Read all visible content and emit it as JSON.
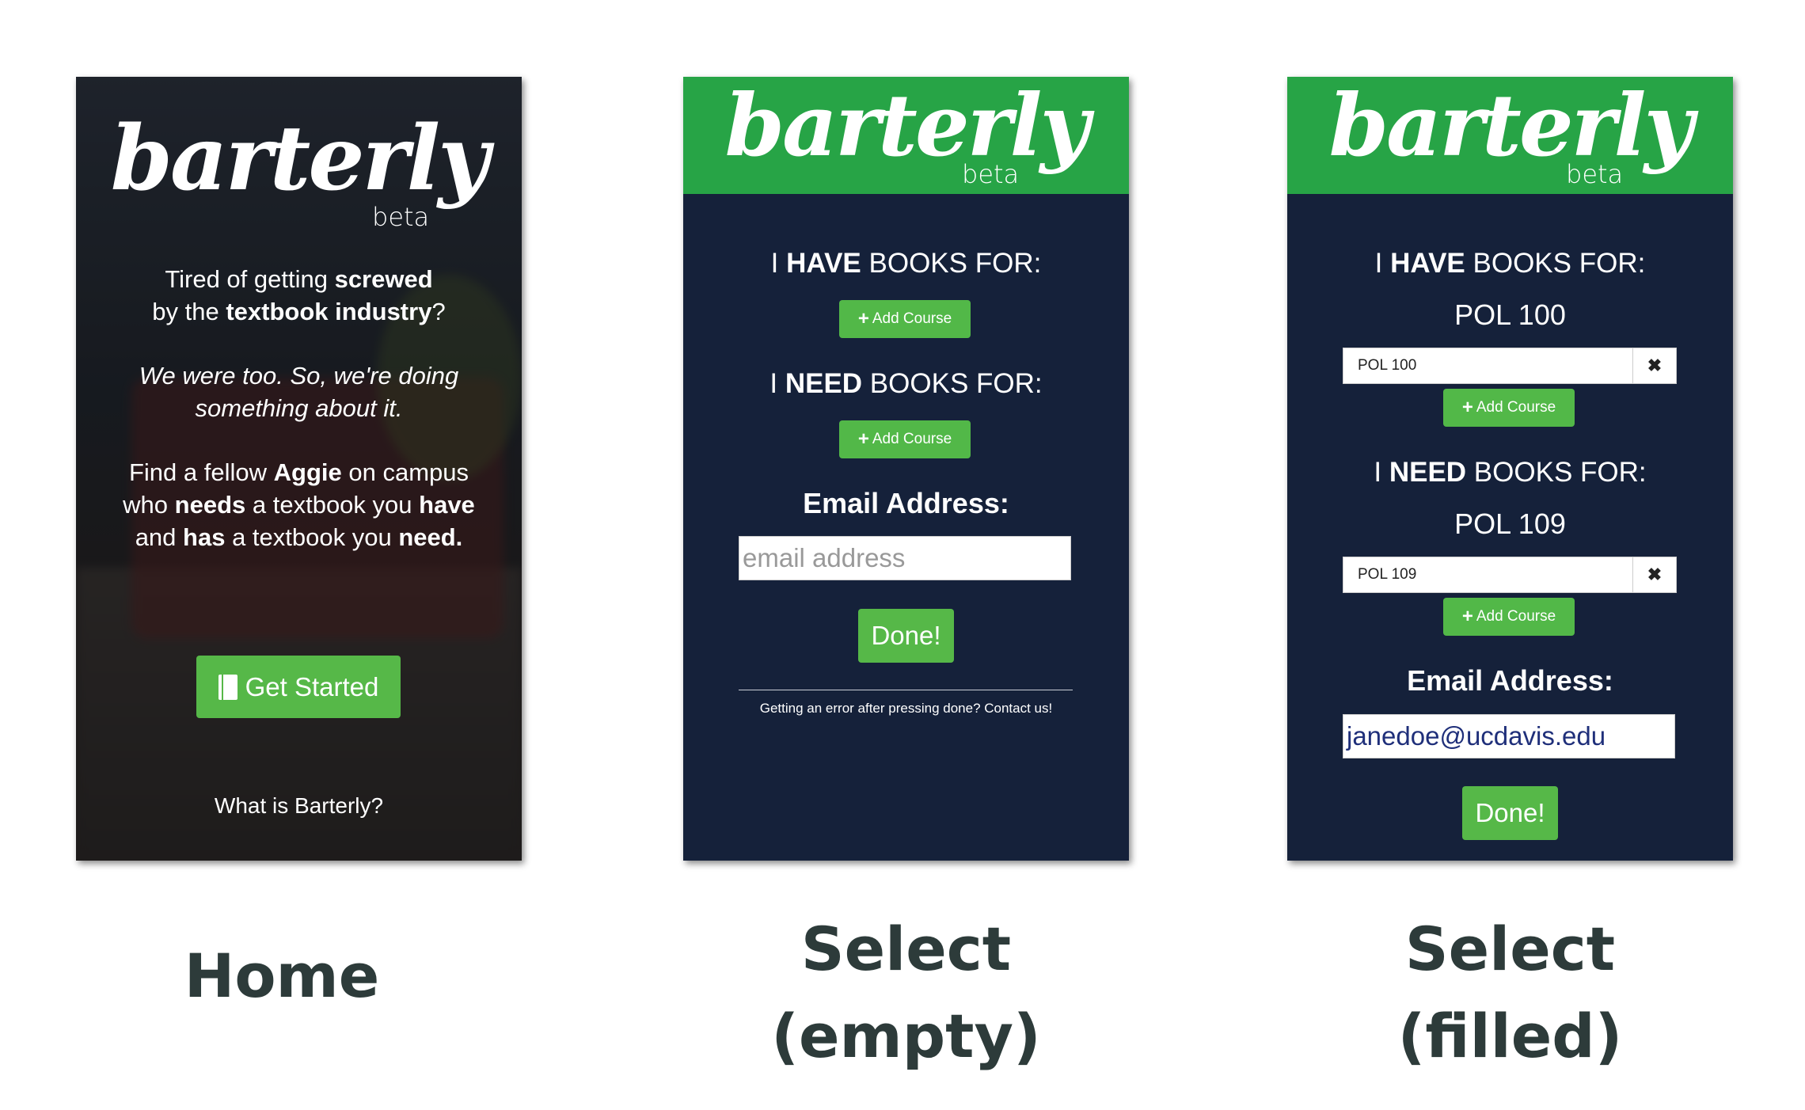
{
  "logo": {
    "wordmark": "barterly",
    "beta": "beta"
  },
  "home": {
    "line1a": "Tired of getting ",
    "line1b": "screwed",
    "line2a": "by the ",
    "line2b": "textbook industry",
    "line2c": "?",
    "para2_line1": "We were too. So, we're doing",
    "para2_line2": "something about it.",
    "p3_1a": "Find a fellow ",
    "p3_1b": "Aggie",
    "p3_1c": " on campus",
    "p3_2a": "who ",
    "p3_2b": "needs",
    "p3_2c": " a textbook you ",
    "p3_2d": "have",
    "p3_3a": "and ",
    "p3_3b": "has",
    "p3_3c": " a textbook you ",
    "p3_3d": "need.",
    "get_started": "Get Started",
    "what_is": "What is Barterly?"
  },
  "select": {
    "have_prefix": "I ",
    "have_bold": "HAVE",
    "have_suffix": " BOOKS FOR:",
    "need_prefix": "I ",
    "need_bold": "NEED",
    "need_suffix": " BOOKS FOR:",
    "add_course": "Add Course",
    "email_label": "Email Address:",
    "email_placeholder": "email address",
    "done": "Done!",
    "contact": "Getting an error after pressing done? Contact us!"
  },
  "filled": {
    "have_course": "POL 100",
    "have_tag": "POL 100",
    "need_course": "POL 109",
    "need_tag": "POL 109",
    "email_value": "janedoe@ucdavis.edu"
  },
  "captions": {
    "home": "Home",
    "empty_1": "Select",
    "empty_2": "(empty)",
    "filled_1": "Select",
    "filled_2": "(filled)"
  },
  "colors": {
    "green": "#27a446",
    "button_green": "#56b848",
    "navy": "#15213a",
    "caption": "#2d3b3a"
  }
}
